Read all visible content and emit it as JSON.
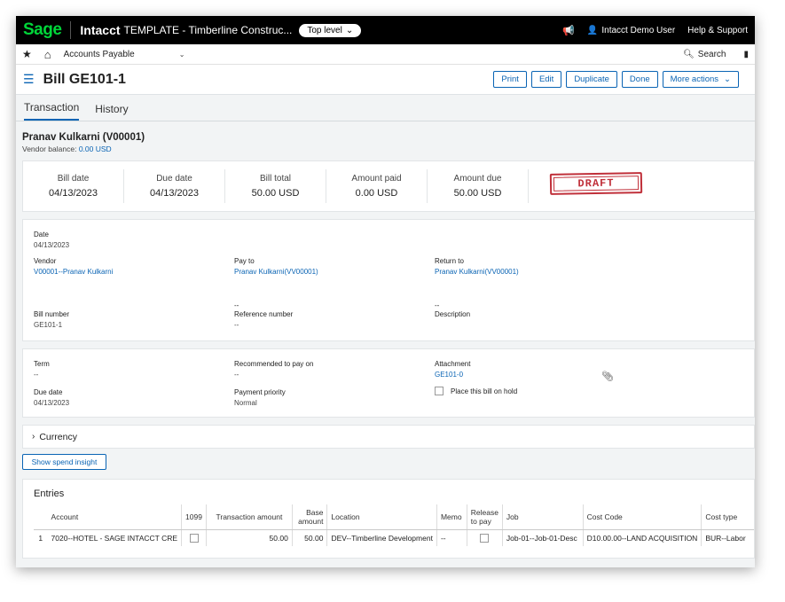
{
  "topbar": {
    "logo": "Sage",
    "app_name": "Intacct",
    "company": "TEMPLATE - Timberline Construc...",
    "top_level": "Top level",
    "user": "Intacct Demo User",
    "help": "Help & Support"
  },
  "nav": {
    "module": "Accounts Payable",
    "search": "Search"
  },
  "page": {
    "title": "Bill GE101-1",
    "actions": {
      "print": "Print",
      "edit": "Edit",
      "duplicate": "Duplicate",
      "done": "Done",
      "more": "More actions"
    }
  },
  "tabs": {
    "transaction": "Transaction",
    "history": "History"
  },
  "vendor": {
    "name": "Pranav Kulkarni (V00001)",
    "balance_label": "Vendor balance:",
    "balance_value": "0.00 USD"
  },
  "summary": {
    "bill_date_label": "Bill date",
    "bill_date": "04/13/2023",
    "due_date_label": "Due date",
    "due_date": "04/13/2023",
    "bill_total_label": "Bill total",
    "bill_total": "50.00 USD",
    "amount_paid_label": "Amount paid",
    "amount_paid": "0.00 USD",
    "amount_due_label": "Amount due",
    "amount_due": "50.00 USD",
    "status": "DRAFT"
  },
  "details": {
    "date_label": "Date",
    "date": "04/13/2023",
    "vendor_label": "Vendor",
    "vendor": "V00001--Pranav Kulkarni",
    "pay_to_label": "Pay to",
    "pay_to": "Pranav Kulkarni(VV00001)",
    "return_to_label": "Return to",
    "return_to": "Pranav Kulkarni(VV00001)",
    "pay_to_extra": "--",
    "return_to_extra": "--",
    "bill_number_label": "Bill number",
    "bill_number": "GE101-1",
    "reference_label": "Reference number",
    "reference": "--",
    "description_label": "Description"
  },
  "terms": {
    "term_label": "Term",
    "term": "--",
    "recommended_label": "Recommended to pay on",
    "recommended": "--",
    "attachment_label": "Attachment",
    "attachment": "GE101-0",
    "hold_label": "Place this bill on hold",
    "due_date_label": "Due date",
    "due_date": "04/13/2023",
    "priority_label": "Payment priority",
    "priority": "Normal"
  },
  "currency": {
    "label": "Currency"
  },
  "spend_insight": "Show spend insight",
  "entries": {
    "title": "Entries",
    "columns": [
      "Account",
      "1099",
      "Transaction amount",
      "Base amount",
      "Location",
      "Memo",
      "Release to pay",
      "Job",
      "Cost Code",
      "Cost type"
    ],
    "rows": [
      {
        "index": "1",
        "account": "7020--HOTEL - SAGE INTACCT CRE",
        "transaction_amount": "50.00",
        "base_amount": "50.00",
        "location": "DEV--Timberline Development",
        "memo": "--",
        "job": "Job-01--Job-01-Desc",
        "cost_code": "D10.00.00--LAND ACQUISITION",
        "cost_type": "BUR--Labor"
      }
    ]
  },
  "colors": {
    "brand_green": "#00d639",
    "link_blue": "#0a64b4",
    "draft_red": "#c0303a"
  }
}
